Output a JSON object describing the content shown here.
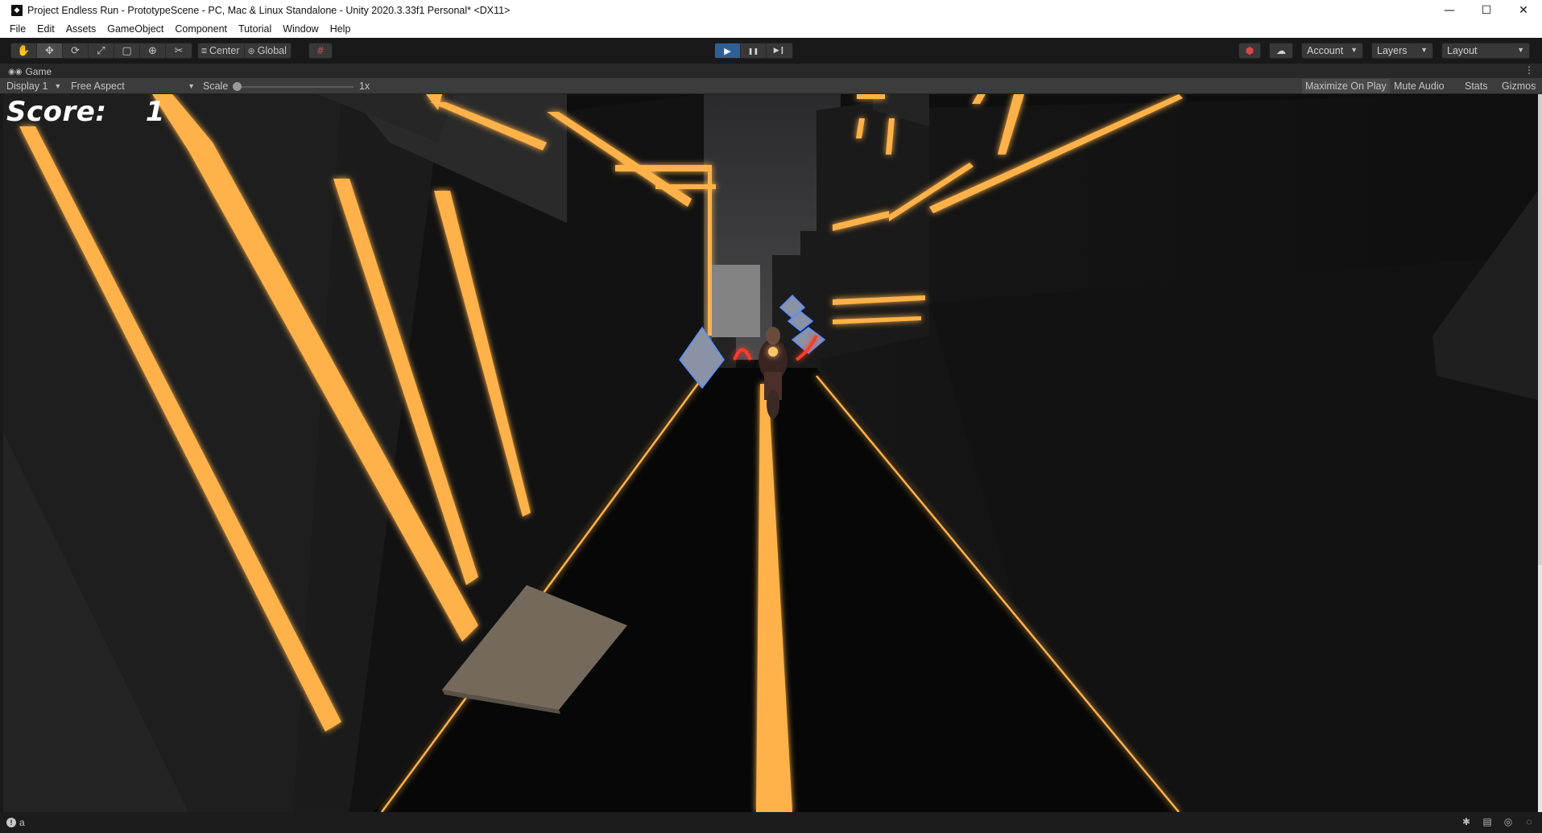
{
  "window": {
    "title": "Project Endless Run - PrototypeScene - PC, Mac & Linux Standalone - Unity 2020.3.33f1 Personal* <DX11>",
    "app_icon": "unity-icon",
    "controls": {
      "minimize": "—",
      "maximize": "☐",
      "close": "✕"
    }
  },
  "menu": {
    "items": [
      "File",
      "Edit",
      "Assets",
      "GameObject",
      "Component",
      "Tutorial",
      "Window",
      "Help"
    ]
  },
  "toolbar": {
    "tools": [
      {
        "name": "hand-tool-icon",
        "glyph": "✋"
      },
      {
        "name": "move-tool-icon",
        "glyph": "✥"
      },
      {
        "name": "rotate-tool-icon",
        "glyph": "⟳"
      },
      {
        "name": "scale-tool-icon",
        "glyph": "⤢"
      },
      {
        "name": "rect-tool-icon",
        "glyph": "▢"
      },
      {
        "name": "transform-tool-icon",
        "glyph": "⊕"
      },
      {
        "name": "custom-tool-icon",
        "glyph": "✂"
      }
    ],
    "pivot_label": "Center",
    "handle_label": "Global",
    "play_icons": {
      "play": "▶",
      "pause": "❚❚",
      "step": "▶❙"
    },
    "account_label": "Account",
    "layers_label": "Layers",
    "layout_label": "Layout"
  },
  "game_tab": {
    "label": "Game"
  },
  "game_toolbar": {
    "display": "Display 1",
    "aspect": "Free Aspect",
    "scale_label": "Scale",
    "scale_value": "1x",
    "maximize_on_play": "Maximize On Play",
    "mute_audio": "Mute Audio",
    "stats": "Stats",
    "gizmos": "Gizmos"
  },
  "game": {
    "score_label": "Score:",
    "score_value": "1"
  },
  "status": {
    "message": "a"
  },
  "colors": {
    "neon_orange": "#ffb24a",
    "play_active": "#2e5f96",
    "editor_bg": "#191919"
  }
}
